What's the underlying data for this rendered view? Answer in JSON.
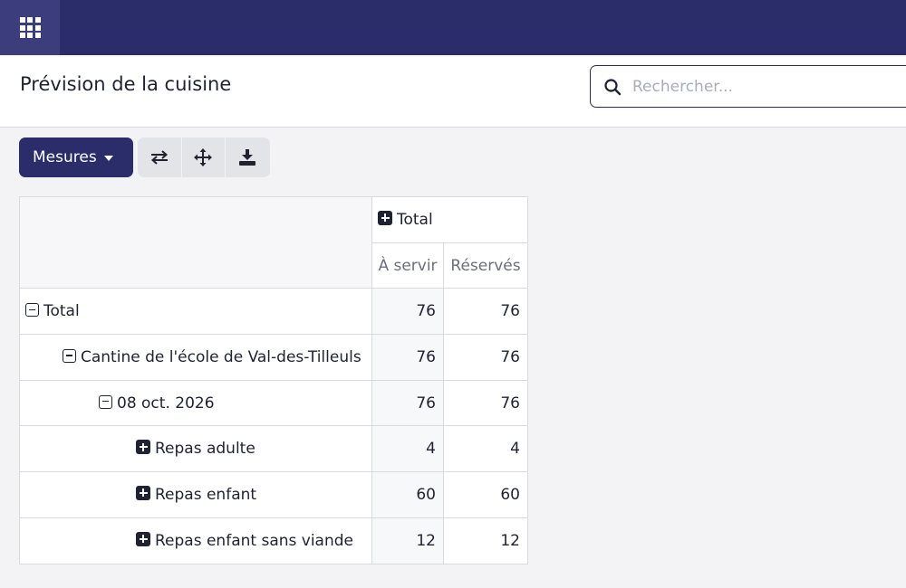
{
  "topbar": {
    "apps_icon": "apps-grid-icon",
    "color": "#2b2d6b"
  },
  "header": {
    "title": "Prévision de la cuisine",
    "search": {
      "placeholder": "Rechercher...",
      "value": ""
    }
  },
  "toolbar": {
    "measures_label": "Mesures",
    "icons": [
      "swap-axes-icon",
      "expand-all-icon",
      "download-icon"
    ]
  },
  "pivot": {
    "column_group": "Total",
    "measures": [
      "À servir",
      "Réservés"
    ],
    "rows": [
      {
        "label": "Total",
        "level": 0,
        "state": "expanded",
        "values": [
          "76",
          "76"
        ]
      },
      {
        "label": "Cantine de l'école de Val-des-Tilleuls",
        "level": 1,
        "state": "expanded",
        "values": [
          "76",
          "76"
        ]
      },
      {
        "label": "08 oct. 2026",
        "level": 2,
        "state": "expanded",
        "values": [
          "76",
          "76"
        ]
      },
      {
        "label": "Repas adulte",
        "level": 3,
        "state": "collapsed",
        "values": [
          "4",
          "4"
        ]
      },
      {
        "label": "Repas enfant",
        "level": 3,
        "state": "collapsed",
        "values": [
          "60",
          "60"
        ]
      },
      {
        "label": "Repas enfant sans viande",
        "level": 3,
        "state": "collapsed",
        "values": [
          "12",
          "12"
        ]
      }
    ]
  }
}
